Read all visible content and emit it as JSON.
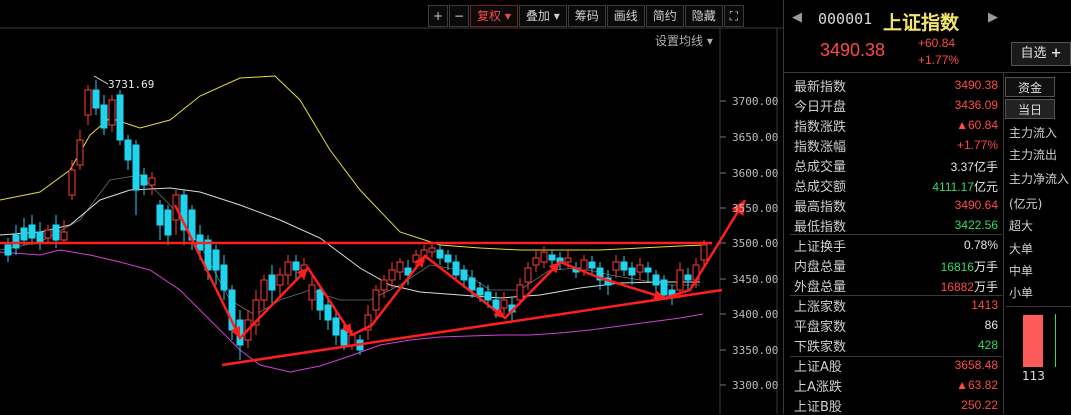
{
  "toolbar": {
    "plus": "+",
    "minus": "−",
    "fuquan": "复权",
    "diejia": "叠加",
    "chouma": "筹码",
    "huaxian": "画线",
    "jianyue": "简约",
    "yincang": "隐藏",
    "fullscreen_icon": "fullscreen-icon"
  },
  "chart": {
    "ma_setting": "设置均线",
    "peak_label": "3731.69",
    "y_labels": [
      "3700.00",
      "3650.00",
      "3600.00",
      "3550.00",
      "3500.00",
      "3450.00",
      "3400.00",
      "3350.00",
      "3300.00"
    ],
    "up_color": "#ff3b3b",
    "down_color": "#22d3ee"
  },
  "panel": {
    "code": "000001",
    "name": "上证指数",
    "price": "3490.38",
    "change": "+60.84",
    "change_pct": "+1.77%",
    "zixuan": "自选",
    "zixuan_icon": "+",
    "rows": [
      {
        "label": "最新指数",
        "value": "3490.38",
        "cls": "red"
      },
      {
        "label": "今日开盘",
        "value": "3436.09",
        "cls": "red"
      },
      {
        "label": "指数涨跌",
        "value": "▲60.84",
        "cls": "red"
      },
      {
        "label": "指数涨幅",
        "value": "+1.77%",
        "cls": "red"
      },
      {
        "label": "总成交量",
        "value": "3.37",
        "unit": "亿手",
        "cls": "white"
      },
      {
        "label": "总成交额",
        "value": "4111.17",
        "unit": "亿元",
        "cls": "green"
      },
      {
        "label": "最高指数",
        "value": "3490.64",
        "cls": "red"
      },
      {
        "label": "最低指数",
        "value": "3422.56",
        "cls": "green"
      },
      {
        "label": "上证换手",
        "value": "0.78%",
        "cls": "white"
      },
      {
        "label": "内盘总量",
        "value": "16816",
        "unit": "万手",
        "cls": "green"
      },
      {
        "label": "外盘总量",
        "value": "16882",
        "unit": "万手",
        "cls": "red"
      },
      {
        "label": "上涨家数",
        "value": "1413",
        "cls": "red"
      },
      {
        "label": "平盘家数",
        "value": "86",
        "cls": "white"
      },
      {
        "label": "下跌家数",
        "value": "428",
        "cls": "green"
      },
      {
        "label": "上证A股",
        "value": "3658.48",
        "cls": "red"
      },
      {
        "label": "上A涨跌",
        "value": "▲63.82",
        "cls": "red"
      },
      {
        "label": "上证B股",
        "value": "250.22",
        "cls": "red"
      }
    ],
    "tabs": {
      "zijin": "资金",
      "dangri": "当日"
    },
    "flows": [
      "主力流入",
      "主力流出",
      "主力净流入",
      "(亿元)",
      "超大",
      "大单",
      "中单",
      "小单"
    ],
    "bar_value": "113"
  }
}
